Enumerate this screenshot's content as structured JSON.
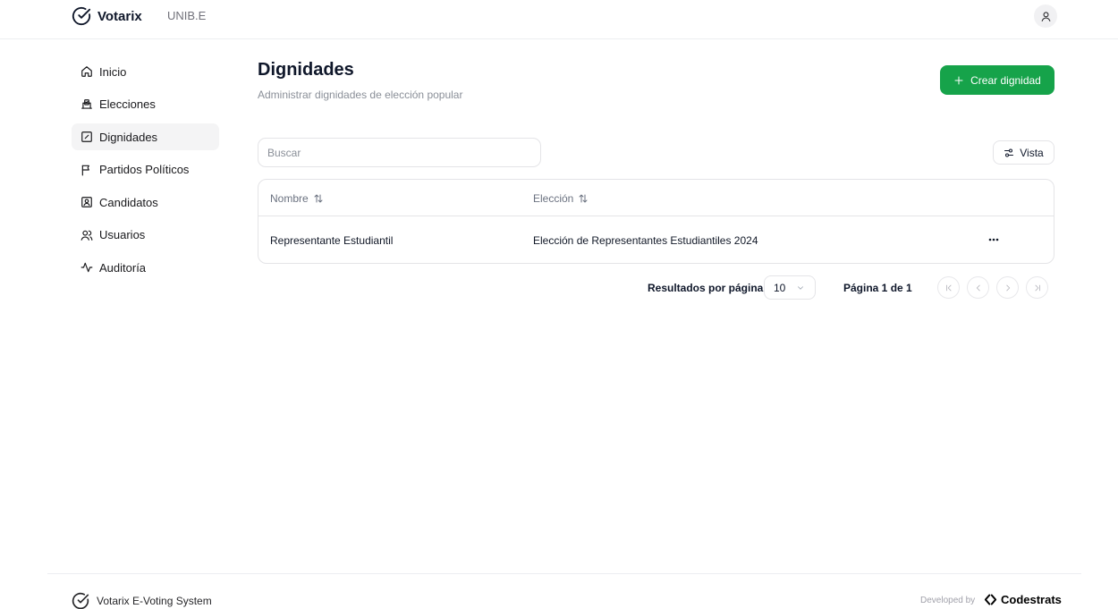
{
  "header": {
    "brand": "Votarix",
    "organization": "UNIB.E"
  },
  "sidebar": {
    "items": [
      {
        "label": "Inicio",
        "icon": "home-icon",
        "active": false
      },
      {
        "label": "Elecciones",
        "icon": "ballot-box-icon",
        "active": false
      },
      {
        "label": "Dignidades",
        "icon": "square-pen-icon",
        "active": true
      },
      {
        "label": "Partidos Políticos",
        "icon": "flag-icon",
        "active": false
      },
      {
        "label": "Candidatos",
        "icon": "contact-card-icon",
        "active": false
      },
      {
        "label": "Usuarios",
        "icon": "users-icon",
        "active": false
      },
      {
        "label": "Auditoría",
        "icon": "activity-icon",
        "active": false
      }
    ]
  },
  "main": {
    "title": "Dignidades",
    "subtitle": "Administrar dignidades de elección popular",
    "create_button": "Crear dignidad",
    "search_placeholder": "Buscar",
    "view_button": "Vista",
    "table": {
      "columns": [
        "Nombre",
        "Elección"
      ],
      "rows": [
        {
          "nombre": "Representante Estudiantil",
          "eleccion": "Elección de Representantes Estudiantiles 2024"
        }
      ]
    },
    "pagination": {
      "per_page_label": "Resultados por página",
      "per_page_value": "10",
      "page_indicator": "Página 1 de 1"
    }
  },
  "footer": {
    "system_name": "Votarix E-Voting System",
    "developed_by": "Developed by",
    "developer": "Codestrats"
  },
  "colors": {
    "accent": "#16a34a",
    "active_nav_bg": "#f4f4f5",
    "border": "#e4e4e7",
    "muted_text": "#8a8f98"
  }
}
